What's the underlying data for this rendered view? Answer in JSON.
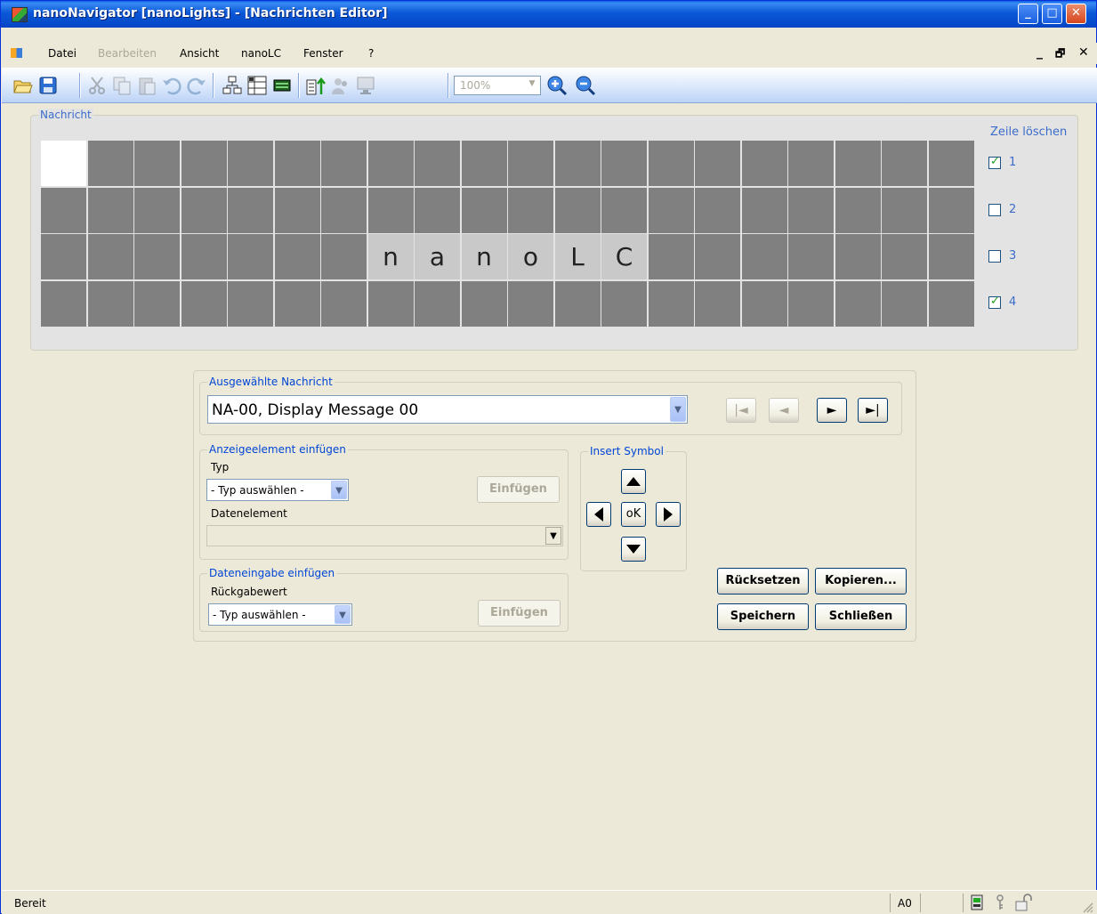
{
  "window": {
    "title": "nanoNavigator [nanoLights] - [Nachrichten Editor]",
    "minimize_glyph": "_",
    "maximize_glyph": "□",
    "close_glyph": "✕"
  },
  "menu": {
    "items": [
      "Datei",
      "Bearbeiten",
      "Ansicht",
      "nanoLC",
      "Fenster",
      "?"
    ],
    "disabled": [
      "Bearbeiten"
    ],
    "mdi_minimize": "_",
    "mdi_restore": "🗗",
    "mdi_close": "✕"
  },
  "toolbar": {
    "buttons": [
      "open-icon",
      "save-icon",
      "cut-icon",
      "copy-icon",
      "paste-icon",
      "undo-icon",
      "redo-icon",
      "tree-icon",
      "table-icon",
      "list-icon",
      "upload-icon",
      "users-icon",
      "monitor-icon",
      "zoom-in-icon",
      "zoom-out-icon"
    ],
    "zoom_value": "100%"
  },
  "nachricht": {
    "legend": "Nachricht",
    "rows": [
      [
        "",
        "",
        "",
        "",
        "",
        "",
        "",
        "",
        "",
        "",
        "",
        "",
        "",
        "",
        "",
        "",
        "",
        "",
        "",
        ""
      ],
      [
        "",
        "",
        "",
        "",
        "",
        "",
        "",
        "",
        "",
        "",
        "",
        "",
        "",
        "",
        "",
        "",
        "",
        "",
        "",
        ""
      ],
      [
        "",
        "",
        "",
        "",
        "",
        "",
        "",
        "n",
        "a",
        "n",
        "o",
        "L",
        "C",
        "",
        "",
        "",
        "",
        "",
        "",
        ""
      ],
      [
        "",
        "",
        "",
        "",
        "",
        "",
        "",
        "",
        "",
        "",
        "",
        "",
        "",
        "",
        "",
        "",
        "",
        "",
        "",
        ""
      ]
    ],
    "zeile_loeschen_label": "Zeile löschen",
    "zeilen": [
      {
        "label": "1",
        "checked": true
      },
      {
        "label": "2",
        "checked": false
      },
      {
        "label": "3",
        "checked": false
      },
      {
        "label": "4",
        "checked": true
      }
    ]
  },
  "auswahl": {
    "legend": "Ausgewählte Nachricht",
    "selected": "NA-00,  Display Message 00",
    "nav": {
      "first": "|◄",
      "prev": "◄",
      "next": "►",
      "last": "►|"
    }
  },
  "anzeige": {
    "legend": "Anzeigeelement einfügen",
    "typ_label": "Typ",
    "typ_value": "- Typ auswählen -",
    "datenelement_label": "Datenelement",
    "datenelement_value": "",
    "insert_label": "Einfügen"
  },
  "dateneingabe": {
    "legend": "Dateneingabe einfügen",
    "rueckgabe_label": "Rückgabewert",
    "typ_value": "- Typ auswählen -",
    "insert_label": "Einfügen"
  },
  "symbol": {
    "legend": "Insert Symbol",
    "ok_label": "oK"
  },
  "actions": {
    "reset": "Rücksetzen",
    "copy": "Kopieren...",
    "save": "Speichern",
    "close": "Schließen"
  },
  "status": {
    "text": "Bereit",
    "code": "A0"
  },
  "colors": {
    "title_bar": "#0b57d8",
    "lcd_off": "#808080",
    "lcd_lit": "#c9c9c9",
    "group_label": "#0046d5"
  }
}
